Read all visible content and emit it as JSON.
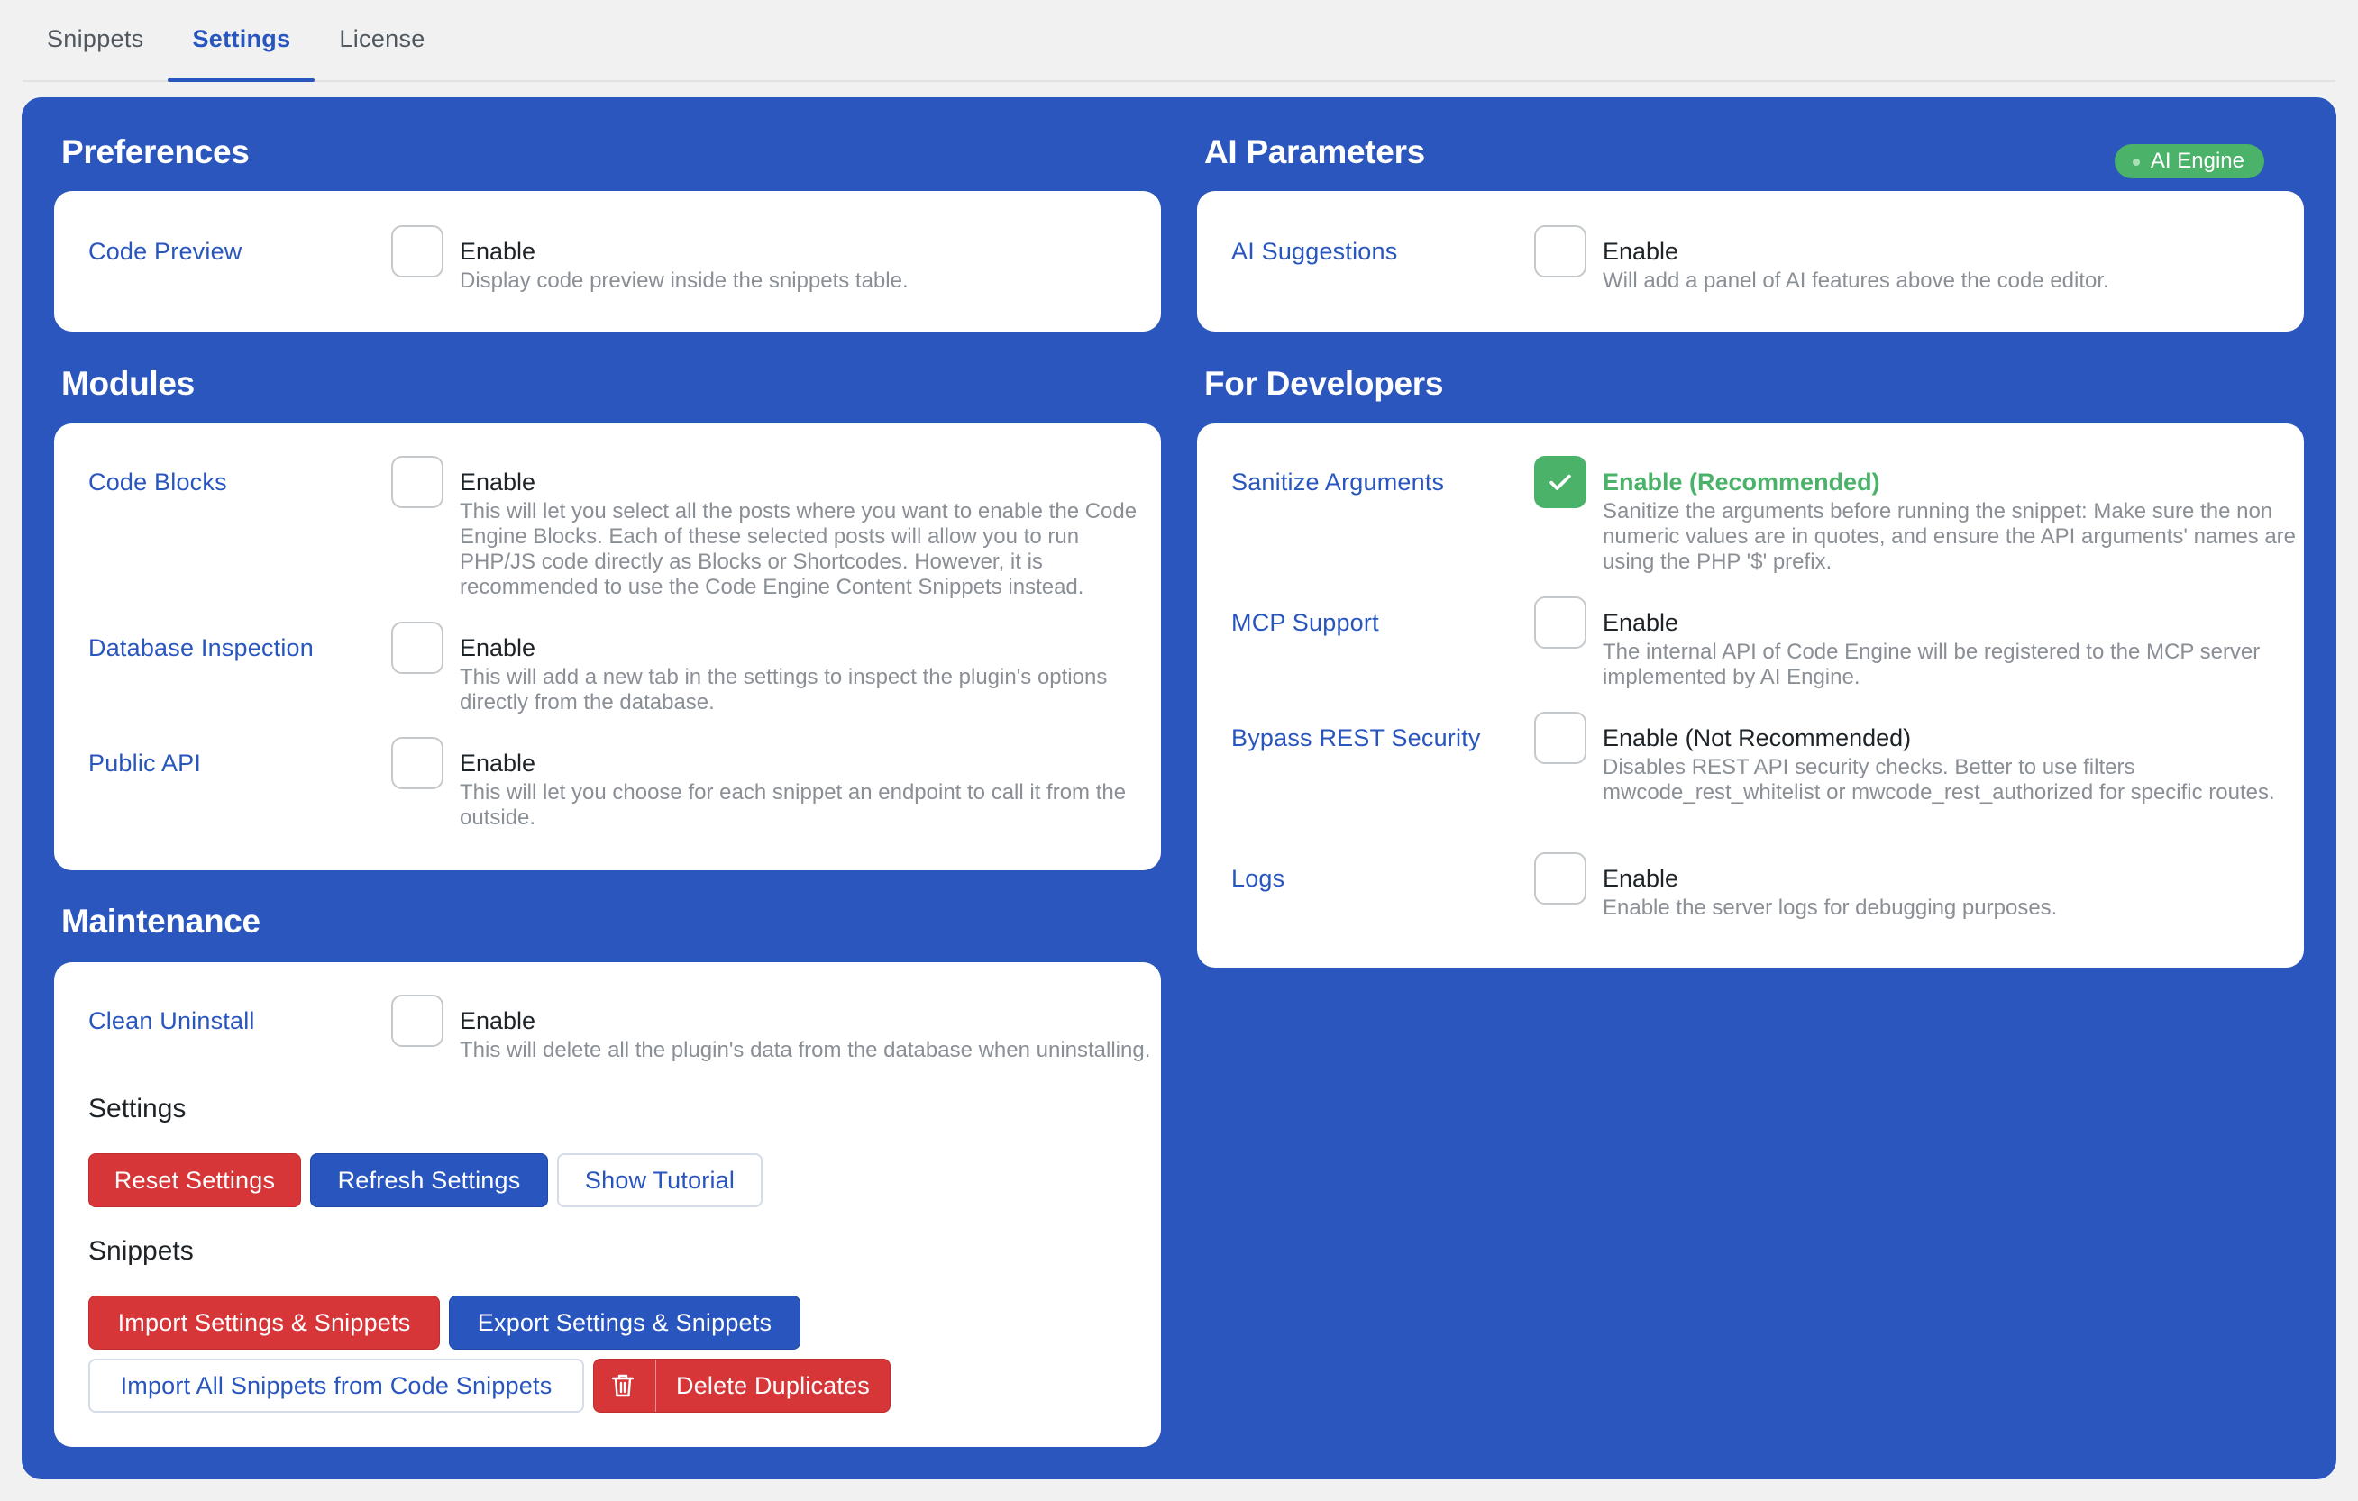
{
  "tabs": [
    {
      "label": "Snippets",
      "active": false
    },
    {
      "label": "Settings",
      "active": true
    },
    {
      "label": "License",
      "active": false
    }
  ],
  "colors": {
    "accent": "#2856be",
    "panel": "#2b56be",
    "success": "#4bb269",
    "danger": "#d63638"
  },
  "preferences": {
    "title": "Preferences",
    "items": [
      {
        "label": "Code Preview",
        "checked": false,
        "option": "Enable",
        "description": "Display code preview inside the snippets table."
      }
    ]
  },
  "modules": {
    "title": "Modules",
    "items": [
      {
        "label": "Code Blocks",
        "checked": false,
        "option": "Enable",
        "description": "This will let you select all the posts where you want to enable the Code Engine Blocks. Each of these selected posts will allow you to run PHP/JS code directly as Blocks or Shortcodes. However, it is recommended to use the Code Engine Content Snippets instead."
      },
      {
        "label": "Database Inspection",
        "checked": false,
        "option": "Enable",
        "description": "This will add a new tab in the settings to inspect the plugin's options directly from the database."
      },
      {
        "label": "Public API",
        "checked": false,
        "option": "Enable",
        "description": "This will let you choose for each snippet an endpoint to call it from the outside."
      }
    ]
  },
  "maintenance": {
    "title": "Maintenance",
    "items": [
      {
        "label": "Clean Uninstall",
        "checked": false,
        "option": "Enable",
        "description": "This will delete all the plugin's data from the database when uninstalling."
      }
    ],
    "settings_heading": "Settings",
    "settings_buttons": {
      "reset": "Reset Settings",
      "refresh": "Refresh Settings",
      "tutorial": "Show Tutorial"
    },
    "snippets_heading": "Snippets",
    "snippets_buttons": {
      "import": "Import Settings & Snippets",
      "export": "Export Settings & Snippets",
      "import_code_snippets": "Import All Snippets from Code Snippets",
      "delete_duplicates": "Delete Duplicates"
    }
  },
  "ai_parameters": {
    "title": "AI Parameters",
    "badge": "AI Engine",
    "items": [
      {
        "label": "AI Suggestions",
        "checked": false,
        "option": "Enable",
        "description": "Will add a panel of AI features above the code editor."
      }
    ]
  },
  "for_developers": {
    "title": "For Developers",
    "items": [
      {
        "label": "Sanitize Arguments",
        "checked": true,
        "option": "Enable (Recommended)",
        "description": "Sanitize the arguments before running the snippet: Make sure the non numeric values are in quotes, and ensure the API arguments' names are using the PHP '$' prefix."
      },
      {
        "label": "MCP Support",
        "checked": false,
        "option": "Enable",
        "description": "The internal API of Code Engine will be registered to the MCP server implemented by AI Engine."
      },
      {
        "label": "Bypass REST Security",
        "checked": false,
        "option": "Enable (Not Recommended)",
        "description": "Disables REST API security checks. Better to use filters mwcode_rest_whitelist or mwcode_rest_authorized for specific routes."
      },
      {
        "label": "Logs",
        "checked": false,
        "option": "Enable",
        "description": "Enable the server logs for debugging purposes."
      }
    ]
  }
}
